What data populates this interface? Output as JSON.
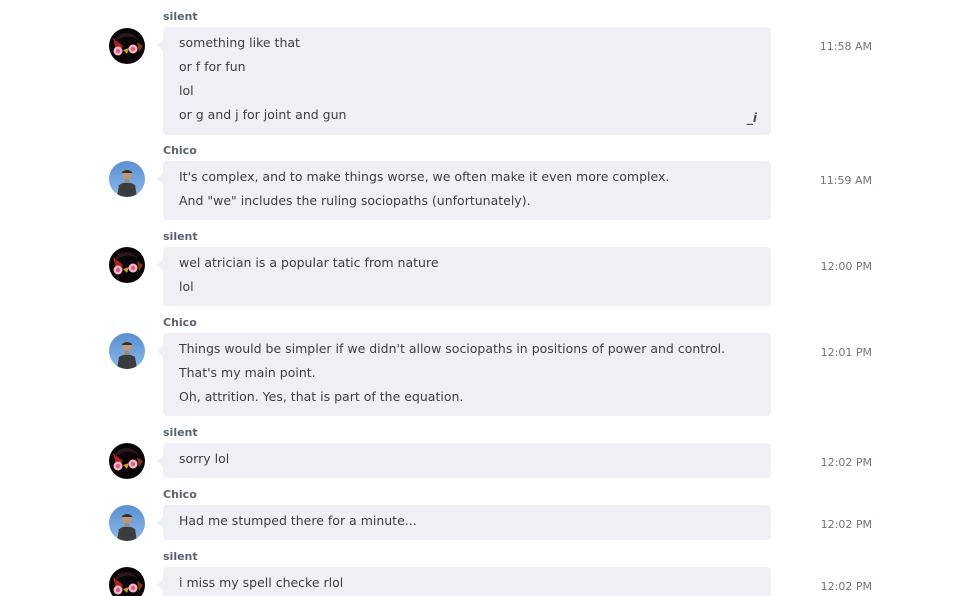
{
  "messages": [
    {
      "sender": "silent",
      "time": "11:58 AM",
      "avatar": "silent-avatar",
      "lines": [
        "something like that",
        "or f for fun",
        "lol",
        "or g and j for joint and gun"
      ],
      "edit_mark": "_i"
    },
    {
      "sender": "Chico",
      "time": "11:59 AM",
      "avatar": "chico-avatar",
      "lines": [
        "It's complex, and to make things worse, we often make it even more complex.",
        "And \"we\" includes the ruling sociopaths (unfortunately)."
      ]
    },
    {
      "sender": "silent",
      "time": "12:00 PM",
      "avatar": "silent-avatar",
      "lines": [
        "wel atrician is a popular tatic from nature",
        "lol"
      ]
    },
    {
      "sender": "Chico",
      "time": "12:01 PM",
      "avatar": "chico-avatar",
      "lines": [
        "Things would be simpler if we didn't allow sociopaths in positions of power and control.",
        "That's my main point.",
        "Oh, attrition.  Yes, that is part of the equation."
      ]
    },
    {
      "sender": "silent",
      "time": "12:02 PM",
      "avatar": "silent-avatar",
      "lines": [
        "sorry lol"
      ]
    },
    {
      "sender": "Chico",
      "time": "12:02 PM",
      "avatar": "chico-avatar",
      "lines": [
        "Had me stumped there for a minute..."
      ]
    },
    {
      "sender": "silent",
      "time": "12:02 PM",
      "avatar": "silent-avatar",
      "lines": [
        "i miss my spell checke rlol"
      ]
    }
  ]
}
